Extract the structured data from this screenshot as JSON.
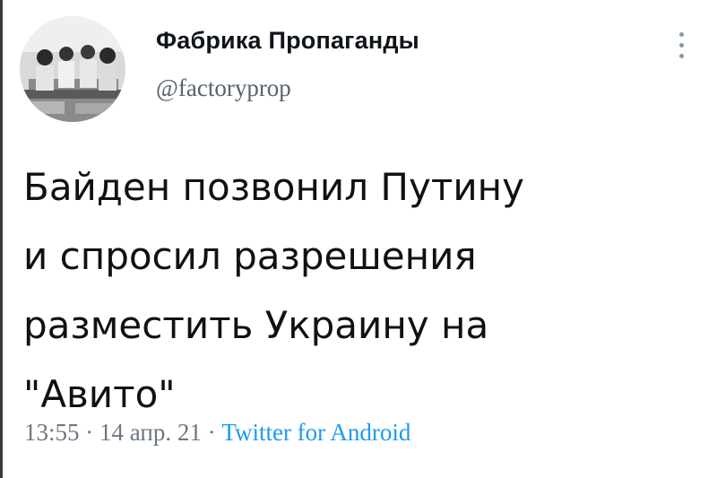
{
  "author": {
    "name": "Фабрика Пропаганды",
    "handle": "@factoryprop",
    "avatar_icon": "avatar-photo-icon"
  },
  "tweet": {
    "text": "Байден позвонил Путину\nи  спросил разрешения\nразместить Украину на\n\"Авито\""
  },
  "meta": {
    "time": "13:55",
    "separator_1": " · ",
    "date": "14 апр. 21",
    "separator_2": " · ",
    "source": "Twitter for Android"
  },
  "colors": {
    "text": "#111111",
    "secondary": "#6b7783",
    "link": "#1d9bf0"
  },
  "icons": {
    "more": "more-vertical-icon"
  }
}
